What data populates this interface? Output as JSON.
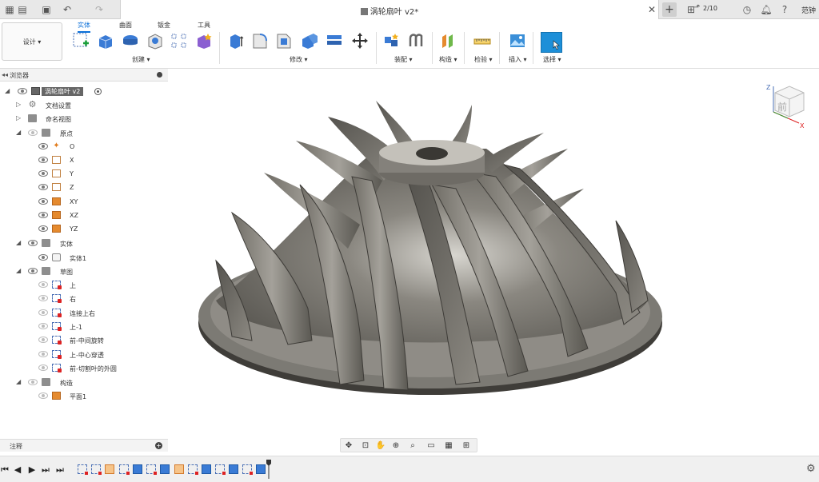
{
  "document": {
    "title": "涡轮扇叶 v2*",
    "job_status": "2/10",
    "user": "范钟"
  },
  "ribbon": {
    "workspace": "设计 ▾",
    "tabs": [
      "实体",
      "曲面",
      "钣金",
      "工具"
    ],
    "groups": [
      "创建 ▾",
      "修改 ▾",
      "装配 ▾",
      "构造 ▾",
      "检验 ▾",
      "插入 ▾",
      "选择 ▾"
    ]
  },
  "browser": {
    "title": "浏览器",
    "root": "涡轮扇叶 v2",
    "items": [
      {
        "label": "文档设置"
      },
      {
        "label": "命名视图"
      },
      {
        "label": "原点"
      },
      {
        "label": "O"
      },
      {
        "label": "X"
      },
      {
        "label": "Y"
      },
      {
        "label": "Z"
      },
      {
        "label": "XY"
      },
      {
        "label": "XZ"
      },
      {
        "label": "YZ"
      },
      {
        "label": "实体"
      },
      {
        "label": "实体1"
      },
      {
        "label": "草图"
      },
      {
        "label": "上"
      },
      {
        "label": "右"
      },
      {
        "label": "连接上右"
      },
      {
        "label": "上-1"
      },
      {
        "label": "前-中间旋转"
      },
      {
        "label": "上-中心穿透"
      },
      {
        "label": "前-切割叶的外圆"
      },
      {
        "label": "构造"
      },
      {
        "label": "平面1"
      }
    ]
  },
  "comments": {
    "title": "注释"
  },
  "viewcube": {
    "face": "前",
    "axes": [
      "Z",
      "X"
    ]
  },
  "colors": {
    "accent": "#0a6fd8",
    "select": "#1d8fd8"
  }
}
